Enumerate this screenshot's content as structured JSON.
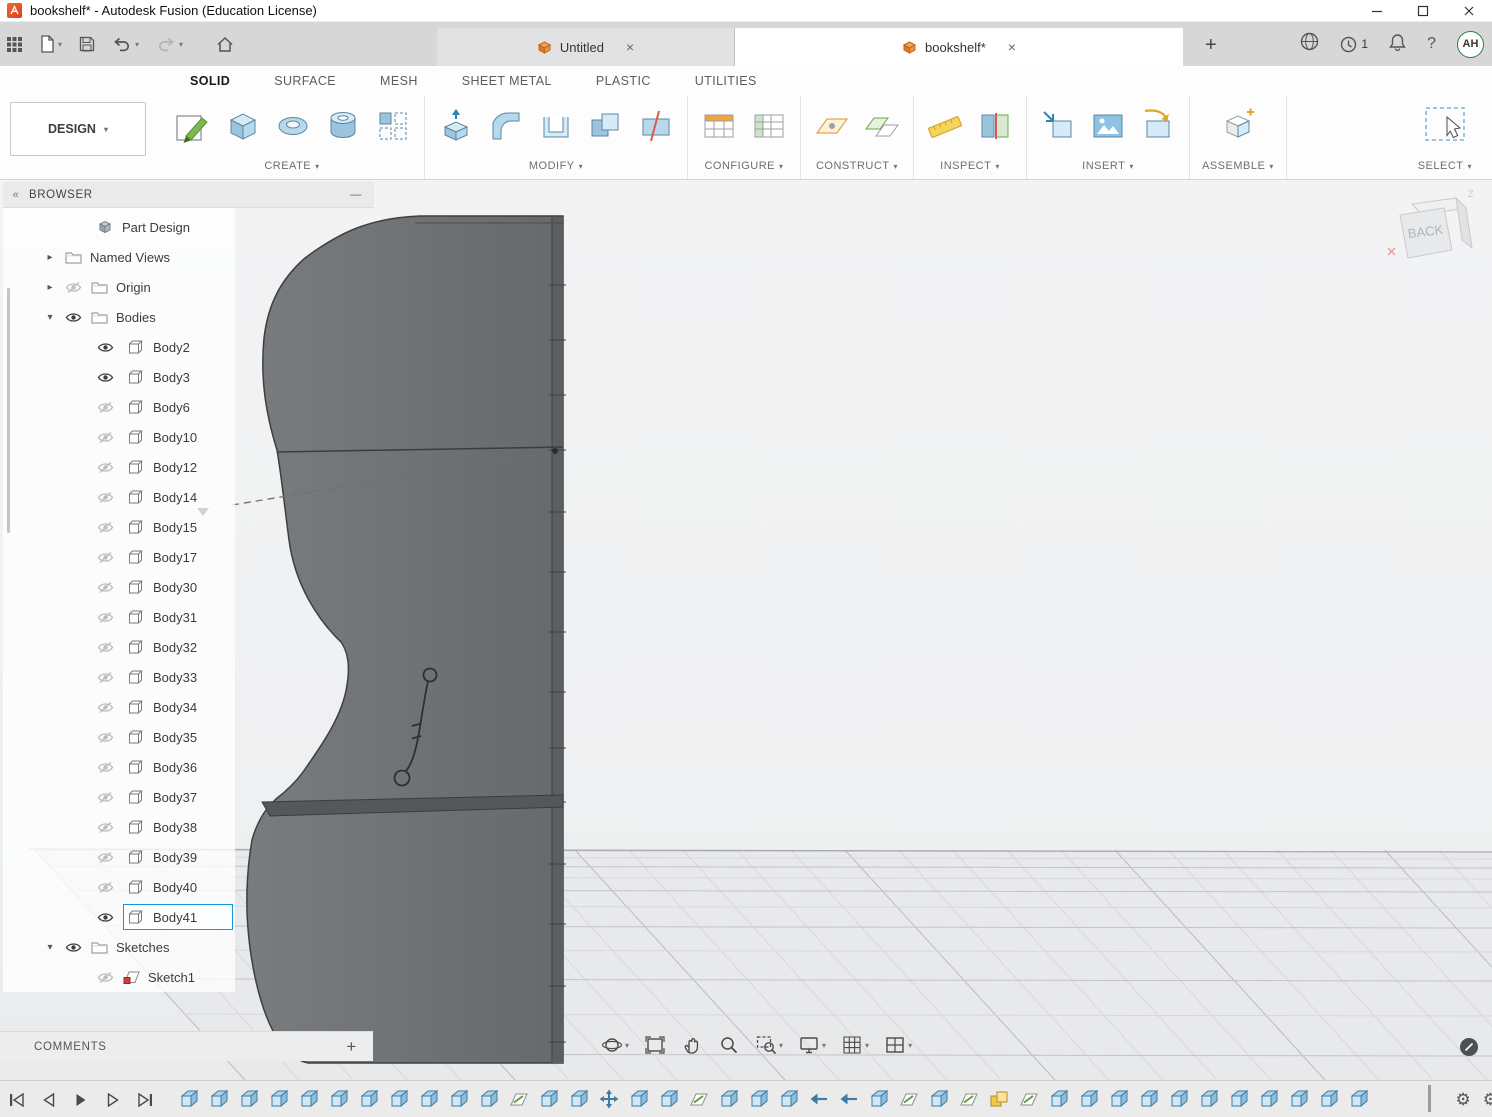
{
  "window": {
    "title": "bookshelf* - Autodesk Fusion (Education License)"
  },
  "quick_access": {
    "job_count": "1",
    "user_initials": "AH",
    "help_glyph": "?"
  },
  "document_tabs": [
    {
      "label": "Untitled",
      "active": false
    },
    {
      "label": "bookshelf*",
      "active": true
    }
  ],
  "ribbon": {
    "workspace_label": "DESIGN",
    "tabs": [
      {
        "label": "SOLID",
        "active": true
      },
      {
        "label": "SURFACE",
        "active": false
      },
      {
        "label": "MESH",
        "active": false
      },
      {
        "label": "SHEET METAL",
        "active": false
      },
      {
        "label": "PLASTIC",
        "active": false
      },
      {
        "label": "UTILITIES",
        "active": false
      }
    ],
    "groups": [
      {
        "label": "CREATE"
      },
      {
        "label": "MODIFY"
      },
      {
        "label": "CONFIGURE"
      },
      {
        "label": "CONSTRUCT"
      },
      {
        "label": "INSPECT"
      },
      {
        "label": "INSERT"
      },
      {
        "label": "ASSEMBLE"
      },
      {
        "label": "SELECT"
      }
    ]
  },
  "browser": {
    "header": "BROWSER",
    "root_label": "Part Design",
    "named_views_label": "Named Views",
    "origin_label": "Origin",
    "bodies_label": "Bodies",
    "sketches_label": "Sketches",
    "sketch_label": "Sketch1",
    "bodies": [
      {
        "label": "Body2",
        "visible": true,
        "selected": false
      },
      {
        "label": "Body3",
        "visible": true,
        "selected": false
      },
      {
        "label": "Body6",
        "visible": false,
        "selected": false
      },
      {
        "label": "Body10",
        "visible": false,
        "selected": false
      },
      {
        "label": "Body12",
        "visible": false,
        "selected": false
      },
      {
        "label": "Body14",
        "visible": false,
        "selected": false
      },
      {
        "label": "Body15",
        "visible": false,
        "selected": false
      },
      {
        "label": "Body17",
        "visible": false,
        "selected": false
      },
      {
        "label": "Body30",
        "visible": false,
        "selected": false
      },
      {
        "label": "Body31",
        "visible": false,
        "selected": false
      },
      {
        "label": "Body32",
        "visible": false,
        "selected": false
      },
      {
        "label": "Body33",
        "visible": false,
        "selected": false
      },
      {
        "label": "Body34",
        "visible": false,
        "selected": false
      },
      {
        "label": "Body35",
        "visible": false,
        "selected": false
      },
      {
        "label": "Body36",
        "visible": false,
        "selected": false
      },
      {
        "label": "Body37",
        "visible": false,
        "selected": false
      },
      {
        "label": "Body38",
        "visible": false,
        "selected": false
      },
      {
        "label": "Body39",
        "visible": false,
        "selected": false
      },
      {
        "label": "Body40",
        "visible": false,
        "selected": false
      },
      {
        "label": "Body41",
        "visible": true,
        "selected": true
      }
    ]
  },
  "comments": {
    "label": "COMMENTS",
    "add_glyph": "+"
  },
  "viewcube": {
    "face_label": "BACK",
    "axis_label": "Z"
  },
  "colors": {
    "selection_blue": "#0f9bd7",
    "fusion_orange": "#e8762d",
    "body_gray": "#6e7174"
  },
  "timeline": {
    "features": [
      "body",
      "body",
      "body",
      "body",
      "body",
      "body",
      "body",
      "body",
      "body",
      "body",
      "body",
      "sketch",
      "body",
      "body",
      "move",
      "body",
      "body",
      "sketch",
      "body",
      "body",
      "body",
      "arrow",
      "arrow",
      "body",
      "sketch",
      "body",
      "sketch",
      "combine",
      "sketch",
      "body",
      "body",
      "body",
      "body",
      "body",
      "body",
      "body",
      "body",
      "body",
      "body",
      "body"
    ]
  }
}
